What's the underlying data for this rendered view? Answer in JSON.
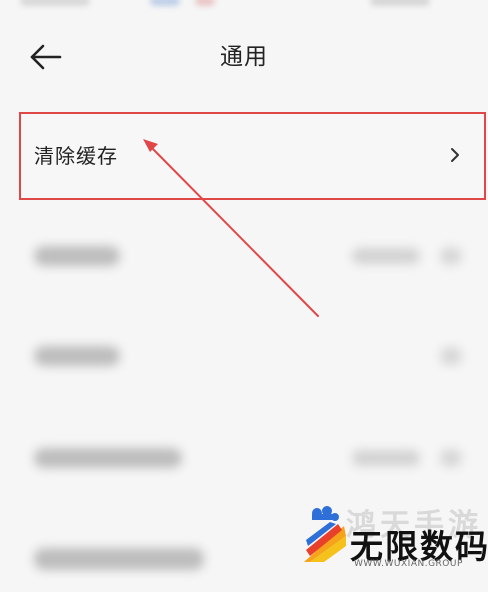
{
  "header": {
    "title": "通用",
    "back_icon": "arrow-left-icon"
  },
  "settings": {
    "clear_cache": {
      "label": "清除缓存",
      "chevron_icon": "chevron-right-icon",
      "highlight_color": "#e04848"
    }
  },
  "annotation": {
    "arrow_color": "#e04848"
  },
  "watermark": {
    "ghost_text": "鸿天手游",
    "main_text": "无限数码",
    "sub_text": "WWW.WUXIAN.GROUP",
    "logo_icon": "wuxian-logo-icon"
  }
}
